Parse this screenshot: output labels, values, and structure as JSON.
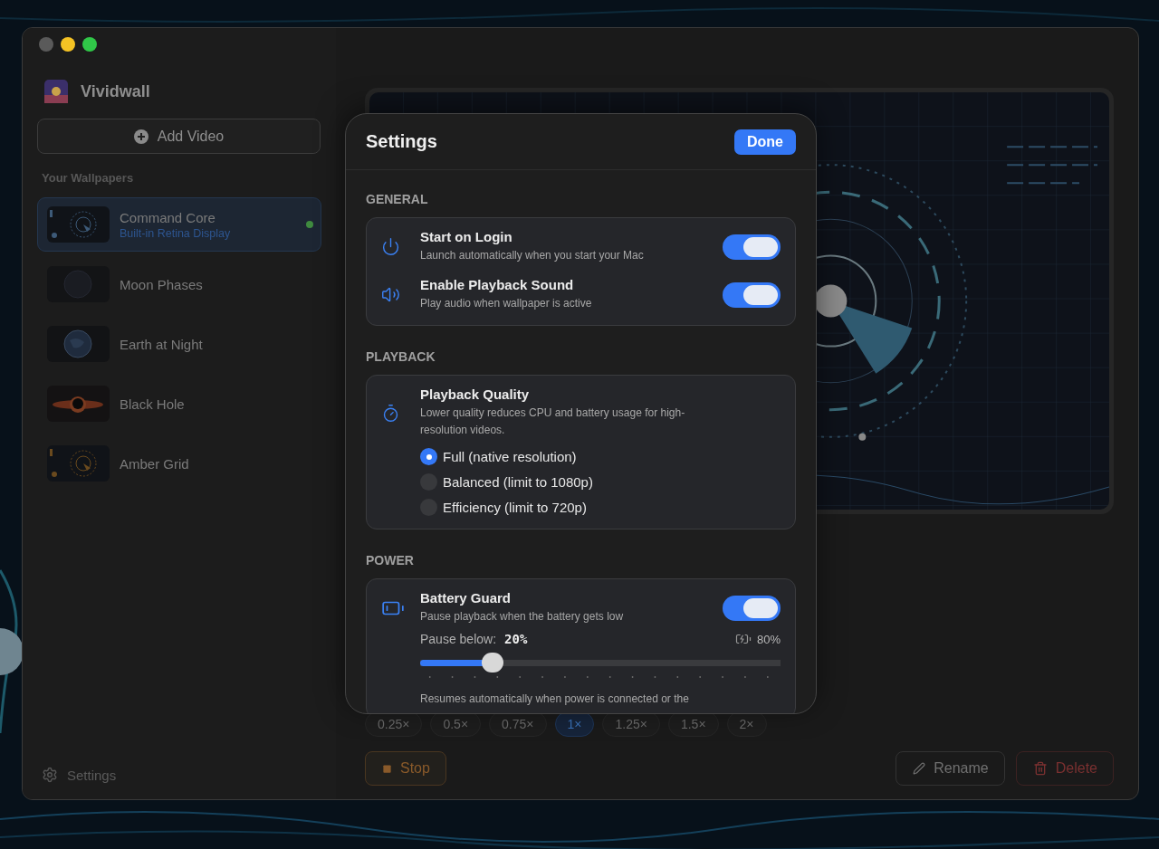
{
  "app": {
    "name": "Vividwall"
  },
  "sidebar": {
    "add_button": "Add Video",
    "section_label": "Your Wallpapers",
    "footer": "Settings",
    "wallpapers": [
      {
        "name": "Command Core",
        "subtitle": "Built-in Retina Display",
        "selected": true,
        "playing": true
      },
      {
        "name": "Moon Phases",
        "selected": false,
        "playing": false
      },
      {
        "name": "Earth at Night",
        "selected": false,
        "playing": false
      },
      {
        "name": "Black Hole",
        "selected": false,
        "playing": false
      },
      {
        "name": "Amber Grid",
        "selected": false,
        "playing": false
      }
    ]
  },
  "speeds": [
    {
      "label": "0.25×",
      "selected": false
    },
    {
      "label": "0.5×",
      "selected": false
    },
    {
      "label": "0.75×",
      "selected": false
    },
    {
      "label": "1×",
      "selected": true
    },
    {
      "label": "1.25×",
      "selected": false
    },
    {
      "label": "1.5×",
      "selected": false
    },
    {
      "label": "2×",
      "selected": false
    }
  ],
  "actions": [
    {
      "kind": "stop",
      "label": "Stop"
    },
    {
      "kind": "rename",
      "label": "Rename"
    },
    {
      "kind": "delete",
      "label": "Delete"
    }
  ],
  "settings": {
    "title": "Settings",
    "done": "Done",
    "sections": [
      {
        "heading": "GENERAL",
        "items": [
          {
            "kind": "toggle",
            "title": "Start on Login",
            "description": "Launch automatically when you start your Mac",
            "on": true
          },
          {
            "kind": "toggle",
            "title": "Enable Playback Sound",
            "description": "Play audio when wallpaper is active",
            "on": true
          }
        ]
      },
      {
        "heading": "PLAYBACK",
        "items": [
          {
            "kind": "choice",
            "title": "Playback Quality",
            "description": "Lower quality reduces CPU and battery usage for high-resolution videos.",
            "options": [
              {
                "label": "Full (native resolution)",
                "selected": true
              },
              {
                "label": "Balanced (limit to 1080p)",
                "selected": false
              },
              {
                "label": "Efficiency (limit to 720p)",
                "selected": false
              }
            ]
          }
        ]
      },
      {
        "heading": "POWER",
        "items": [
          {
            "kind": "battery",
            "title": "Battery Guard",
            "description": "Pause playback when the battery gets low",
            "on": true,
            "slider_label": "Pause below:",
            "slider_value": "20%",
            "level": 0.2,
            "battery_reading": "80%",
            "note": "Resumes automatically when power is connected or the"
          }
        ]
      }
    ]
  }
}
